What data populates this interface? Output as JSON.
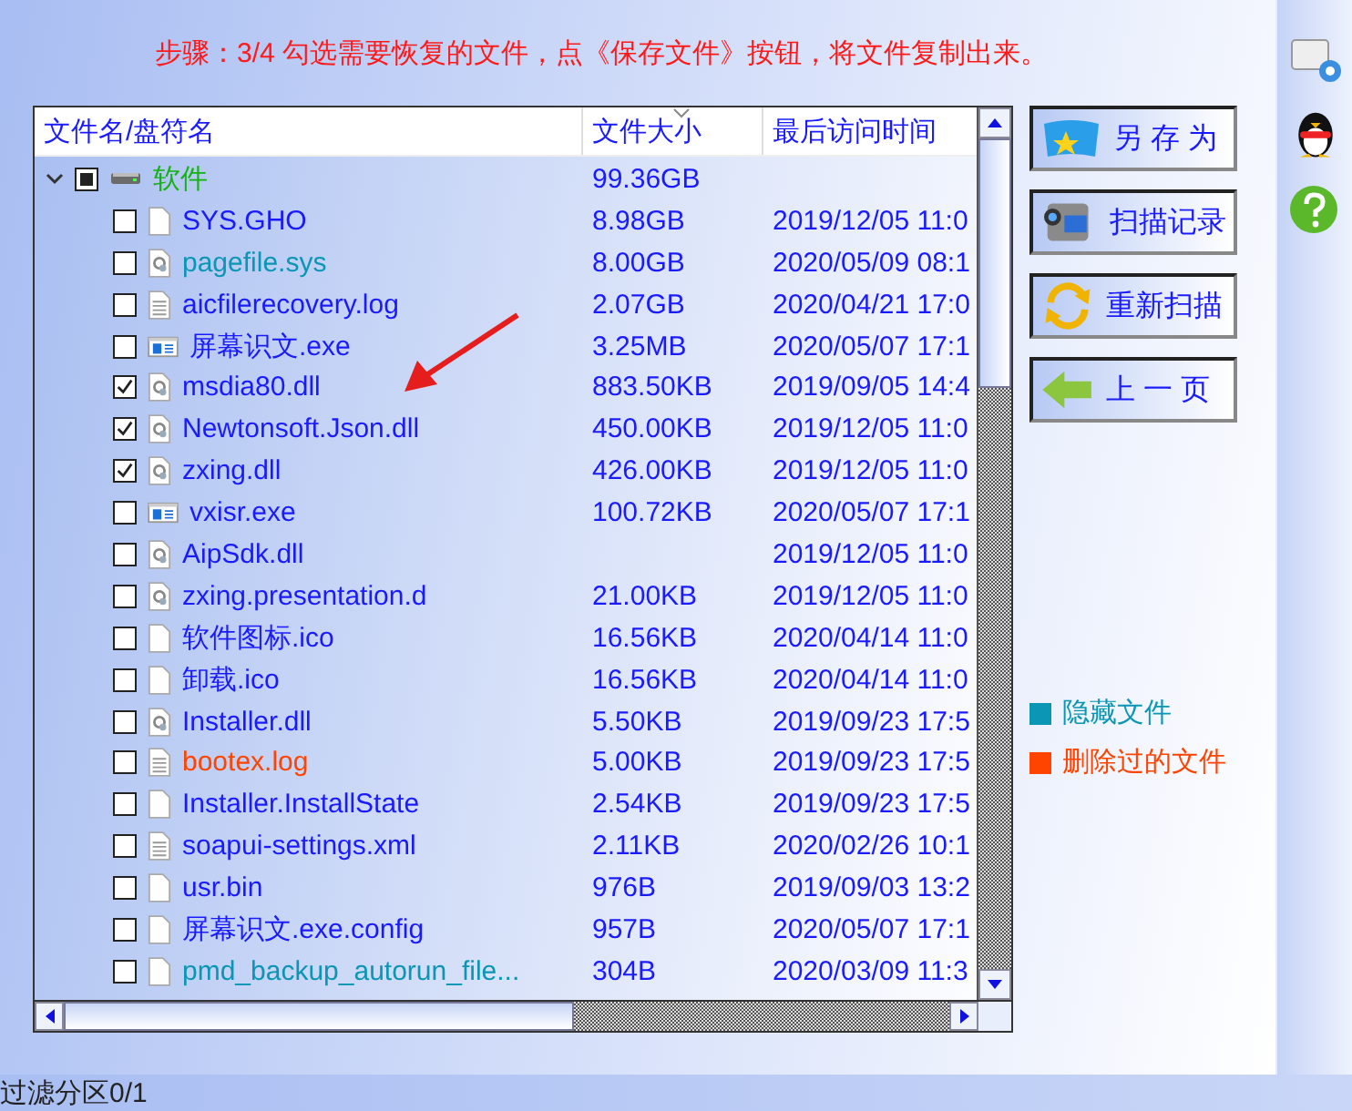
{
  "instruction": "步骤：3/4 勾选需要恢复的文件，点《保存文件》按钮，将文件复制出来。",
  "table": {
    "columns": [
      "文件名/盘符名",
      "文件大小",
      "最后访问时间"
    ],
    "root": {
      "name": "软件",
      "size": "99.36GB",
      "indeterminate": true,
      "expanded": true,
      "children": [
        {
          "name": "SYS.GHO",
          "size": "8.98GB",
          "date": "2019/12/05 11:0",
          "checked": false,
          "kind": "blank",
          "color": "#1a1aff"
        },
        {
          "name": "pagefile.sys",
          "size": "8.00GB",
          "date": "2020/05/09 08:1",
          "checked": false,
          "kind": "gear",
          "color": "#0a96b4"
        },
        {
          "name": "aicfilerecovery.log",
          "size": "2.07GB",
          "date": "2020/04/21 17:0",
          "checked": false,
          "kind": "text",
          "color": "#1a1aff"
        },
        {
          "name": "屏幕识文.exe",
          "size": "3.25MB",
          "date": "2020/05/07 17:1",
          "checked": false,
          "kind": "exe",
          "color": "#1a1aff"
        },
        {
          "name": "msdia80.dll",
          "size": "883.50KB",
          "date": "2019/09/05 14:4",
          "checked": true,
          "kind": "gear",
          "color": "#1a1aff"
        },
        {
          "name": "Newtonsoft.Json.dll",
          "size": "450.00KB",
          "date": "2019/12/05 11:0",
          "checked": true,
          "kind": "gear",
          "color": "#1a1aff"
        },
        {
          "name": "zxing.dll",
          "size": "426.00KB",
          "date": "2019/12/05 11:0",
          "checked": true,
          "kind": "gear",
          "color": "#1a1aff"
        },
        {
          "name": "vxisr.exe",
          "size": "100.72KB",
          "date": "2020/05/07 17:1",
          "checked": false,
          "kind": "exe",
          "color": "#1a1aff"
        },
        {
          "name": "AipSdk.dll",
          "date": "2019/12/05 11:0",
          "checked": false,
          "kind": "gear",
          "color": "#1a1aff"
        },
        {
          "name": "zxing.presentation.d",
          "size": "21.00KB",
          "date": "2019/12/05 11:0",
          "checked": false,
          "kind": "gear",
          "color": "#1a1aff"
        },
        {
          "name": "软件图标.ico",
          "size": "16.56KB",
          "date": "2020/04/14 11:0",
          "checked": false,
          "kind": "blank",
          "color": "#1a1aff"
        },
        {
          "name": "卸载.ico",
          "size": "16.56KB",
          "date": "2020/04/14 11:0",
          "checked": false,
          "kind": "blank",
          "color": "#1a1aff"
        },
        {
          "name": "Installer.dll",
          "size": "5.50KB",
          "date": "2019/09/23 17:5",
          "checked": false,
          "kind": "gear",
          "color": "#1a1aff"
        },
        {
          "name": "bootex.log",
          "size": "5.00KB",
          "date": "2019/09/23 17:5",
          "checked": false,
          "kind": "text",
          "color": "#ff4400"
        },
        {
          "name": "Installer.InstallState",
          "size": "2.54KB",
          "date": "2019/09/23 17:5",
          "checked": false,
          "kind": "blank",
          "color": "#1a1aff"
        },
        {
          "name": "soapui-settings.xml",
          "size": "2.11KB",
          "date": "2020/02/26 10:1",
          "checked": false,
          "kind": "text",
          "color": "#1a1aff"
        },
        {
          "name": "usr.bin",
          "size": "976B",
          "date": "2019/09/03 13:2",
          "checked": false,
          "kind": "blank",
          "color": "#1a1aff"
        },
        {
          "name": "屏幕识文.exe.config",
          "size": "957B",
          "date": "2020/05/07 17:1",
          "checked": false,
          "kind": "blank",
          "color": "#1a1aff"
        },
        {
          "name": "pmd_backup_autorun_file...",
          "size": "304B",
          "date": "2020/03/09 11:3",
          "checked": false,
          "kind": "blank",
          "color": "#0a96b4"
        }
      ]
    }
  },
  "buttons": [
    {
      "label": "另 存 为",
      "kind": "save"
    },
    {
      "label": "扫描记录",
      "kind": "camera"
    },
    {
      "label": "重新扫描",
      "kind": "refresh"
    },
    {
      "label": "上 一 页",
      "kind": "back"
    }
  ],
  "legend": [
    {
      "label": "隐藏文件",
      "color": "#0a96b4"
    },
    {
      "label": "删除过的文件",
      "color": "#ff4400"
    }
  ],
  "sidebar": [
    {
      "kind": "settings"
    },
    {
      "kind": "penguin"
    },
    {
      "kind": "help"
    }
  ],
  "status_bar": "过滤分区0/1"
}
